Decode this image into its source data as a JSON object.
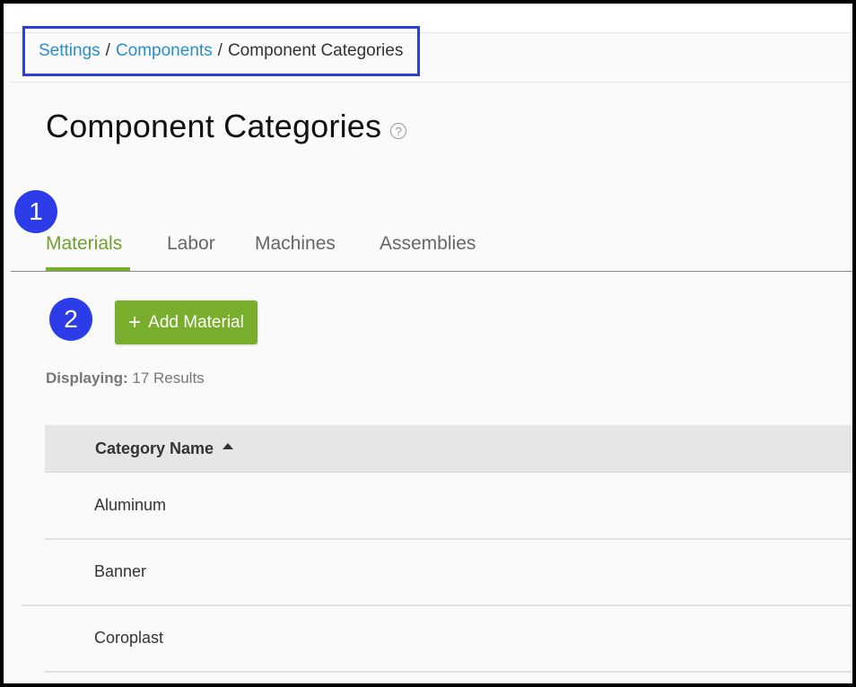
{
  "breadcrumb": {
    "items": [
      {
        "label": "Settings"
      },
      {
        "label": "Components"
      },
      {
        "label": "Component Categories"
      }
    ],
    "separator": "/"
  },
  "page": {
    "title": "Component Categories",
    "help_icon": "?"
  },
  "annotations": {
    "step1": "1",
    "step2": "2"
  },
  "tabs": [
    {
      "label": "Materials",
      "active": true
    },
    {
      "label": "Labor",
      "active": false
    },
    {
      "label": "Machines",
      "active": false
    },
    {
      "label": "Assemblies",
      "active": false
    }
  ],
  "actions": {
    "add_label": "Add Material",
    "add_icon": "+"
  },
  "results": {
    "prefix": "Displaying:",
    "text": "17 Results"
  },
  "table": {
    "column_header": "Category Name",
    "sort": "ascending",
    "rows": [
      "Aluminum",
      "Banner",
      "Coroplast"
    ]
  },
  "colors": {
    "accent_green": "#79ad2c",
    "link_blue": "#2a8fc9",
    "annotation_blue": "#2b3ce8"
  }
}
